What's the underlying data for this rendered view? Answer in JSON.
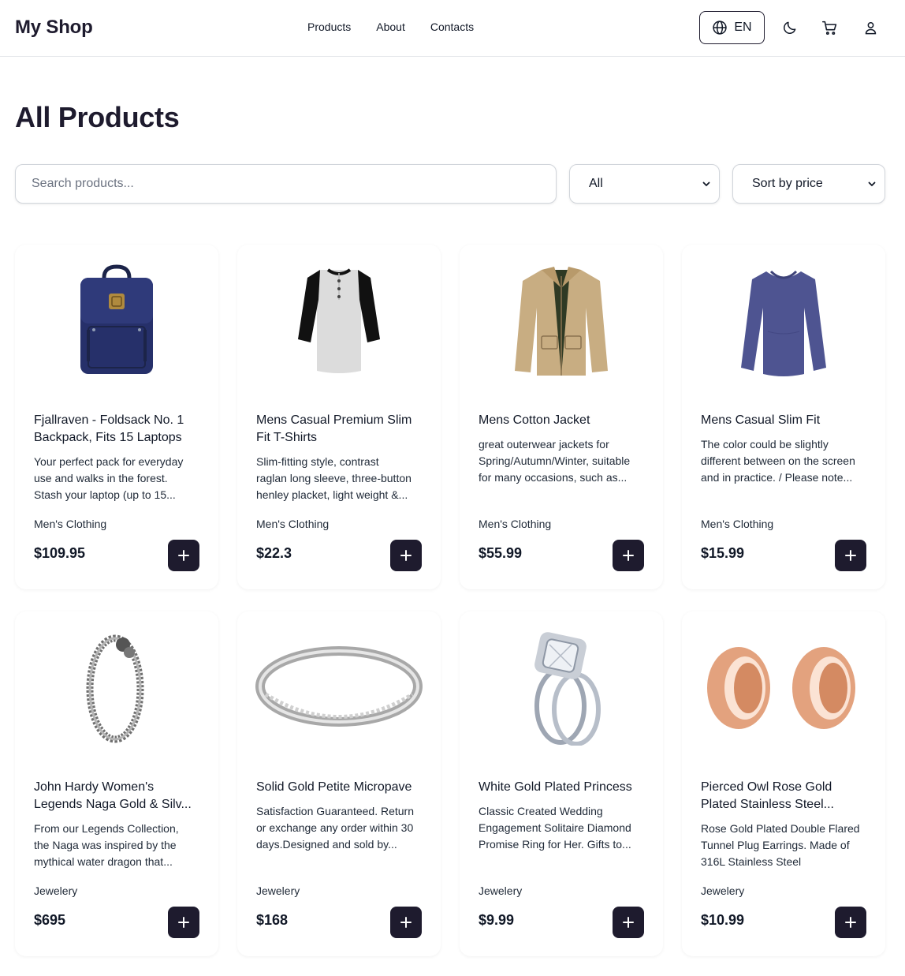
{
  "header": {
    "logo": "My Shop",
    "nav": [
      "Products",
      "About",
      "Contacts"
    ],
    "language": "EN"
  },
  "page_title": "All Products",
  "search": {
    "placeholder": "Search products..."
  },
  "filters": {
    "category_selected": "All",
    "sort_selected": "Sort by price"
  },
  "products": [
    {
      "title": "Fjallraven - Foldsack No. 1 Backpack, Fits 15 Laptops",
      "description_lines": [
        "Your perfect pack for everyday",
        "use and walks in the forest.",
        "Stash your laptop (up to 15..."
      ],
      "category": "Men's Clothing",
      "price": "$109.95",
      "image": "backpack"
    },
    {
      "title": "Mens Casual Premium Slim Fit T-Shirts",
      "description_lines": [
        "Slim-fitting style, contrast",
        "raglan long sleeve, three-button",
        "henley placket, light weight &..."
      ],
      "category": "Men's Clothing",
      "price": "$22.3",
      "image": "raglan-shirt"
    },
    {
      "title": "Mens Cotton Jacket",
      "description_lines": [
        "great outerwear jackets for",
        "Spring/Autumn/Winter, suitable",
        "for many occasions, such as..."
      ],
      "category": "Men's Clothing",
      "price": "$55.99",
      "image": "jacket"
    },
    {
      "title": "Mens Casual Slim Fit",
      "description_lines": [
        "The color could be slightly",
        "different between on the screen",
        "and in practice. / Please note..."
      ],
      "category": "Men's Clothing",
      "price": "$15.99",
      "image": "longsleeve"
    },
    {
      "title": "John Hardy Women's Legends Naga Gold & Silv...",
      "description_lines": [
        "From our Legends Collection,",
        "the Naga was inspired by the",
        "mythical water dragon that..."
      ],
      "category": "Jewelery",
      "price": "$695",
      "image": "bracelet"
    },
    {
      "title": "Solid Gold Petite Micropave",
      "description_lines": [
        "Satisfaction Guaranteed. Return",
        "or exchange any order within 30",
        "days.Designed and sold by..."
      ],
      "category": "Jewelery",
      "price": "$168",
      "image": "ring-band"
    },
    {
      "title": "White Gold Plated Princess",
      "description_lines": [
        "Classic Created Wedding",
        "Engagement Solitaire Diamond",
        "Promise Ring for Her. Gifts to..."
      ],
      "category": "Jewelery",
      "price": "$9.99",
      "image": "diamond-ring"
    },
    {
      "title": "Pierced Owl Rose Gold Plated Stainless Steel...",
      "description_lines": [
        "Rose Gold Plated Double Flared",
        "Tunnel Plug Earrings. Made of",
        "316L Stainless Steel"
      ],
      "category": "Jewelery",
      "price": "$10.99",
      "image": "plug-earrings"
    }
  ]
}
